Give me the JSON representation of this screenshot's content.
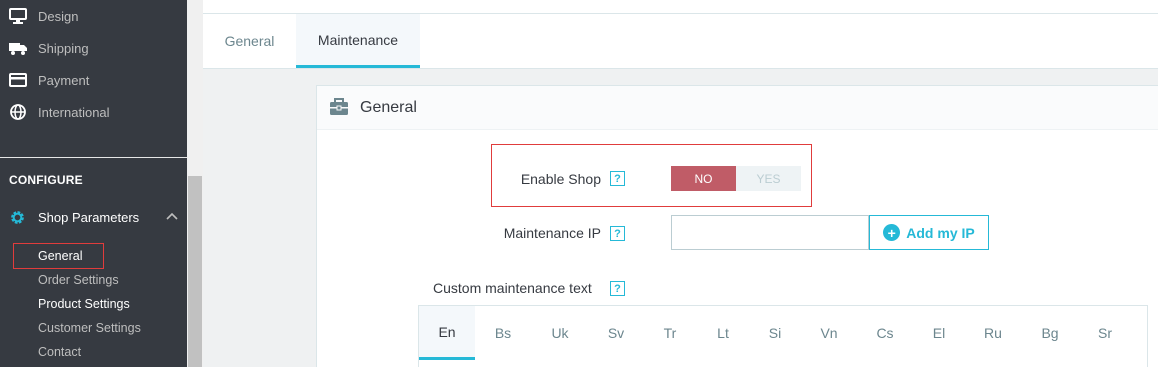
{
  "sidebar": {
    "items": [
      {
        "label": "Design",
        "icon": "monitor-icon"
      },
      {
        "label": "Shipping",
        "icon": "truck-icon"
      },
      {
        "label": "Payment",
        "icon": "credit-card-icon"
      },
      {
        "label": "International",
        "icon": "globe-icon"
      }
    ],
    "section_heading": "CONFIGURE",
    "active_section": {
      "label": "Shop Parameters",
      "icon": "gear-icon"
    },
    "sub_items": [
      {
        "label": "General"
      },
      {
        "label": "Order Settings"
      },
      {
        "label": "Product Settings"
      },
      {
        "label": "Customer Settings"
      },
      {
        "label": "Contact"
      }
    ]
  },
  "tabs": [
    {
      "label": "General"
    },
    {
      "label": "Maintenance"
    }
  ],
  "panel": {
    "title": "General",
    "icon": "briefcase-icon",
    "enable_shop": {
      "label": "Enable Shop",
      "help": "?",
      "no_label": "NO",
      "yes_label": "YES",
      "selected": "NO"
    },
    "maintenance_ip": {
      "label": "Maintenance IP",
      "help": "?",
      "value": "",
      "add_button": "Add my IP"
    },
    "custom_text": {
      "label": "Custom maintenance text",
      "help": "?"
    },
    "languages": [
      "En",
      "Bs",
      "Uk",
      "Sv",
      "Tr",
      "Lt",
      "Si",
      "Vn",
      "Cs",
      "El",
      "Ru",
      "Bg",
      "Sr"
    ],
    "active_language": "En"
  },
  "colors": {
    "sidebar_bg": "#363a41",
    "accent": "#25b9d7",
    "switch_no": "#c05c67",
    "highlight_border": "#e03c3c"
  }
}
